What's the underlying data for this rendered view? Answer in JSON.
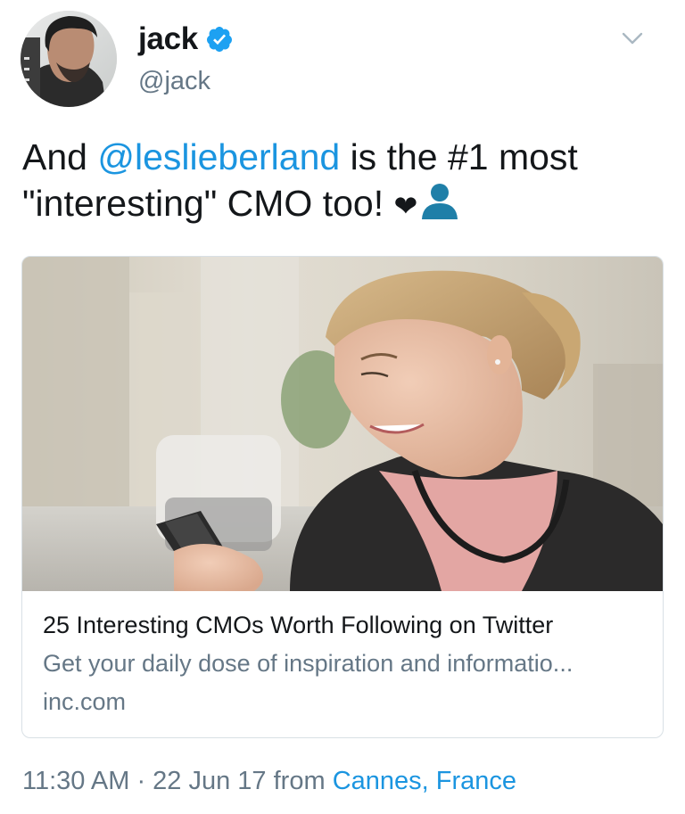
{
  "author": {
    "display_name": "jack",
    "handle": "@jack",
    "verified": true
  },
  "tweet": {
    "text_before": "And ",
    "mention": "@leslieberland",
    "text_after": " is the #1 most \"interesting\" CMO too! ",
    "emoji_heart": "❤",
    "emoji_person": "bust-in-silhouette-icon"
  },
  "card": {
    "title": "25 Interesting CMOs Worth Following on Twitter",
    "description": "Get your daily dose of inspiration and informatio...",
    "domain": "inc.com"
  },
  "meta": {
    "time": "11:30 AM",
    "separator": " · ",
    "date": "22 Jun 17",
    "from_label": " from ",
    "place": "Cannes, France"
  },
  "colors": {
    "link": "#1b95e0",
    "secondary": "#657786",
    "verified": "#1da1f2",
    "emoji_person": "#1f7fa8"
  }
}
